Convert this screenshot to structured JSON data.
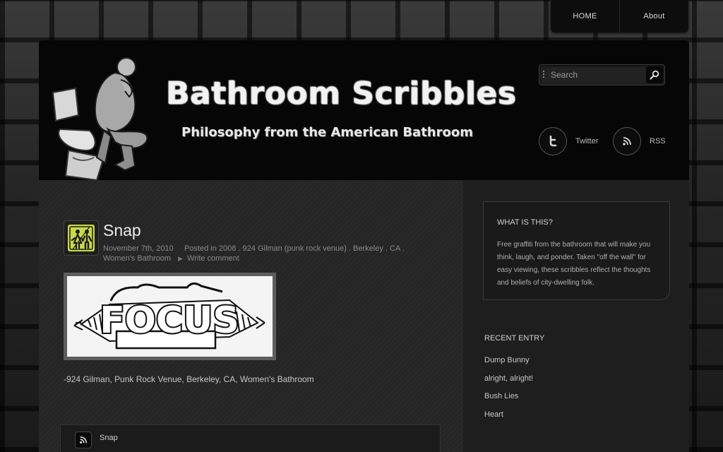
{
  "nav": {
    "items": [
      {
        "label": "HOME"
      },
      {
        "label": "About"
      }
    ]
  },
  "header": {
    "title": "Bathroom Scribbles",
    "tagline": "Philosophy from the American Bathroom",
    "search_placeholder": "Search",
    "social": [
      {
        "label": "Twitter",
        "icon": "twitter-icon"
      },
      {
        "label": "RSS",
        "icon": "rss-icon"
      }
    ]
  },
  "post": {
    "title": "Snap",
    "date": "November 7th, 2010",
    "posted_in_prefix": "Posted in",
    "categories_text": "2008 . 924 Gilman (punk rock venue) . Berkeley . CA . Women's Bathroom",
    "comment_link": "Write comment",
    "image_text": "FOCUS",
    "body": "-924 Gilman, Punk Rock Venue, Berkeley, CA, Women's Bathroom",
    "footer_label": "Snap"
  },
  "sidebar": {
    "about": {
      "heading": "WHAT IS THIS?",
      "text": "Free graffiti from the bathroom that will make you think, laugh, and ponder. Taken \"off the wall\" for easy viewing, these scribbles reflect the thoughts and beliefs of city-dwelling folk."
    },
    "recent": {
      "heading": "RECENT ENTRY",
      "items": [
        "Dump Bunny",
        "alright, alright!",
        "Bush Lies",
        "Heart"
      ]
    }
  },
  "colors": {
    "accent_icon": "#c8d84a",
    "background": "#262626",
    "header": "#060606"
  }
}
